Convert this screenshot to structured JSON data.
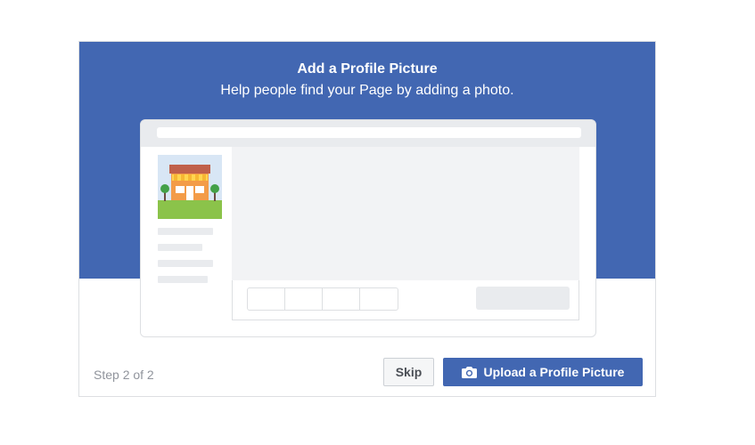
{
  "dialog": {
    "title": "Add a Profile Picture",
    "subtitle": "Help people find your Page by adding a photo."
  },
  "illustration": {
    "avatar_icon": "storefront-icon",
    "colors": {
      "hero": "#4267b2",
      "placeholder": "#e9ebee",
      "content": "#f2f3f5"
    }
  },
  "footer": {
    "step_text": "Step 2 of 2",
    "skip_label": "Skip",
    "upload_label": "Upload a Profile Picture",
    "upload_icon": "camera-icon"
  }
}
